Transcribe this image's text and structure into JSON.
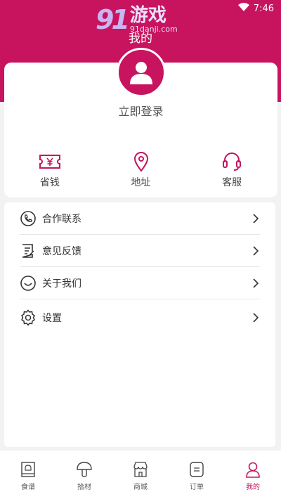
{
  "status_bar": {
    "time": "7:46"
  },
  "watermark": {
    "logo": "91",
    "name": "游戏",
    "url": "91danji.com"
  },
  "header": {
    "title": "我的"
  },
  "profile": {
    "login_label": "立即登录"
  },
  "quick_actions": [
    {
      "label": "省钱",
      "icon": "coupon-yen-icon"
    },
    {
      "label": "地址",
      "icon": "location-pin-icon"
    },
    {
      "label": "客服",
      "icon": "headset-icon"
    }
  ],
  "menu": [
    {
      "label": "合作联系",
      "icon": "phone-icon"
    },
    {
      "label": "意见反馈",
      "icon": "feedback-note-icon"
    },
    {
      "label": "关于我们",
      "icon": "smile-icon"
    },
    {
      "label": "设置",
      "icon": "gear-icon"
    }
  ],
  "tabs": [
    {
      "label": "食谱",
      "icon": "recipe-book-icon"
    },
    {
      "label": "拾材",
      "icon": "mushroom-icon"
    },
    {
      "label": "商城",
      "icon": "store-icon"
    },
    {
      "label": "订单",
      "icon": "order-icon"
    },
    {
      "label": "我的",
      "icon": "user-icon",
      "active": true
    }
  ],
  "colors": {
    "accent": "#c8145f",
    "background": "#f2f2f2"
  }
}
